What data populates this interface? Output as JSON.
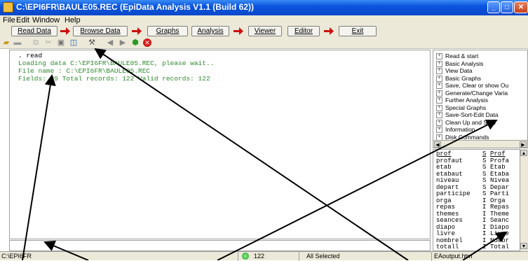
{
  "window": {
    "title": "C:\\EPI6FR\\BAULE05.REC (EpiData Analysis V1.1 (Build 62))"
  },
  "menu": [
    {
      "label": "File",
      "x": 0
    },
    {
      "label": "Edit",
      "x": 0
    },
    {
      "label": "Window",
      "x": 0
    },
    {
      "label": "Help",
      "x": 0
    }
  ],
  "buttons": {
    "read_data": "Read Data",
    "browse_data": "Browse Data",
    "graphs": "Graphs",
    "analysis": "Analysis",
    "viewer": "Viewer",
    "editor": "Editor",
    "exit": "Exit"
  },
  "output": {
    "lines": [
      ". read",
      "Loading data C:\\EPI6FR\\BAULE05.REC, please wait..",
      "File name  : C:\\EPI6FR\\BAULE05.REC",
      "Fields: 39 Total records: 122 Valid records: 122"
    ],
    "command_color": "#000000",
    "result_color": "#2e8b2e"
  },
  "tree": {
    "items": [
      "Read & start",
      "Basic Analysis",
      "View Data",
      "Basic Graphs",
      "Save, Clear or show Ou",
      "Generate/Change Varia",
      "Further Analysis",
      "Special Graphs",
      "Save-Sort-Edit Data",
      "Clean Up and Stop",
      "Information",
      "Disk Commands"
    ]
  },
  "variables": {
    "rows": [
      {
        "name": "prof",
        "type": "S",
        "label": "Prof"
      },
      {
        "name": "profaut",
        "type": "S",
        "label": "Profa"
      },
      {
        "name": "etab",
        "type": "S",
        "label": "Etab"
      },
      {
        "name": "etabaut",
        "type": "S",
        "label": "Etaba"
      },
      {
        "name": "niveau",
        "type": "S",
        "label": "Nivea"
      },
      {
        "name": "depart",
        "type": "S",
        "label": "Depar"
      },
      {
        "name": "participe",
        "type": "S",
        "label": "Parti"
      },
      {
        "name": "orga",
        "type": "I",
        "label": "Orga"
      },
      {
        "name": "repas",
        "type": "I",
        "label": "Repas"
      },
      {
        "name": "themes",
        "type": "I",
        "label": "Theme"
      },
      {
        "name": "seances",
        "type": "I",
        "label": "Seanc"
      },
      {
        "name": "diapo",
        "type": "I",
        "label": "Diapo"
      },
      {
        "name": "livre",
        "type": "I",
        "label": "Livre"
      },
      {
        "name": "nombrel",
        "type": "I",
        "label": "Nombr"
      },
      {
        "name": "totall",
        "type": "I",
        "label": "Total"
      }
    ]
  },
  "status": {
    "path": "C:\\EPI6FR",
    "records": "122",
    "selection": "All Selected",
    "output_file": "EAoutput.htm"
  },
  "colors": {
    "titlebar": "#0a54e0",
    "chrome": "#ece9d8",
    "pin_red": "#cc1010"
  }
}
